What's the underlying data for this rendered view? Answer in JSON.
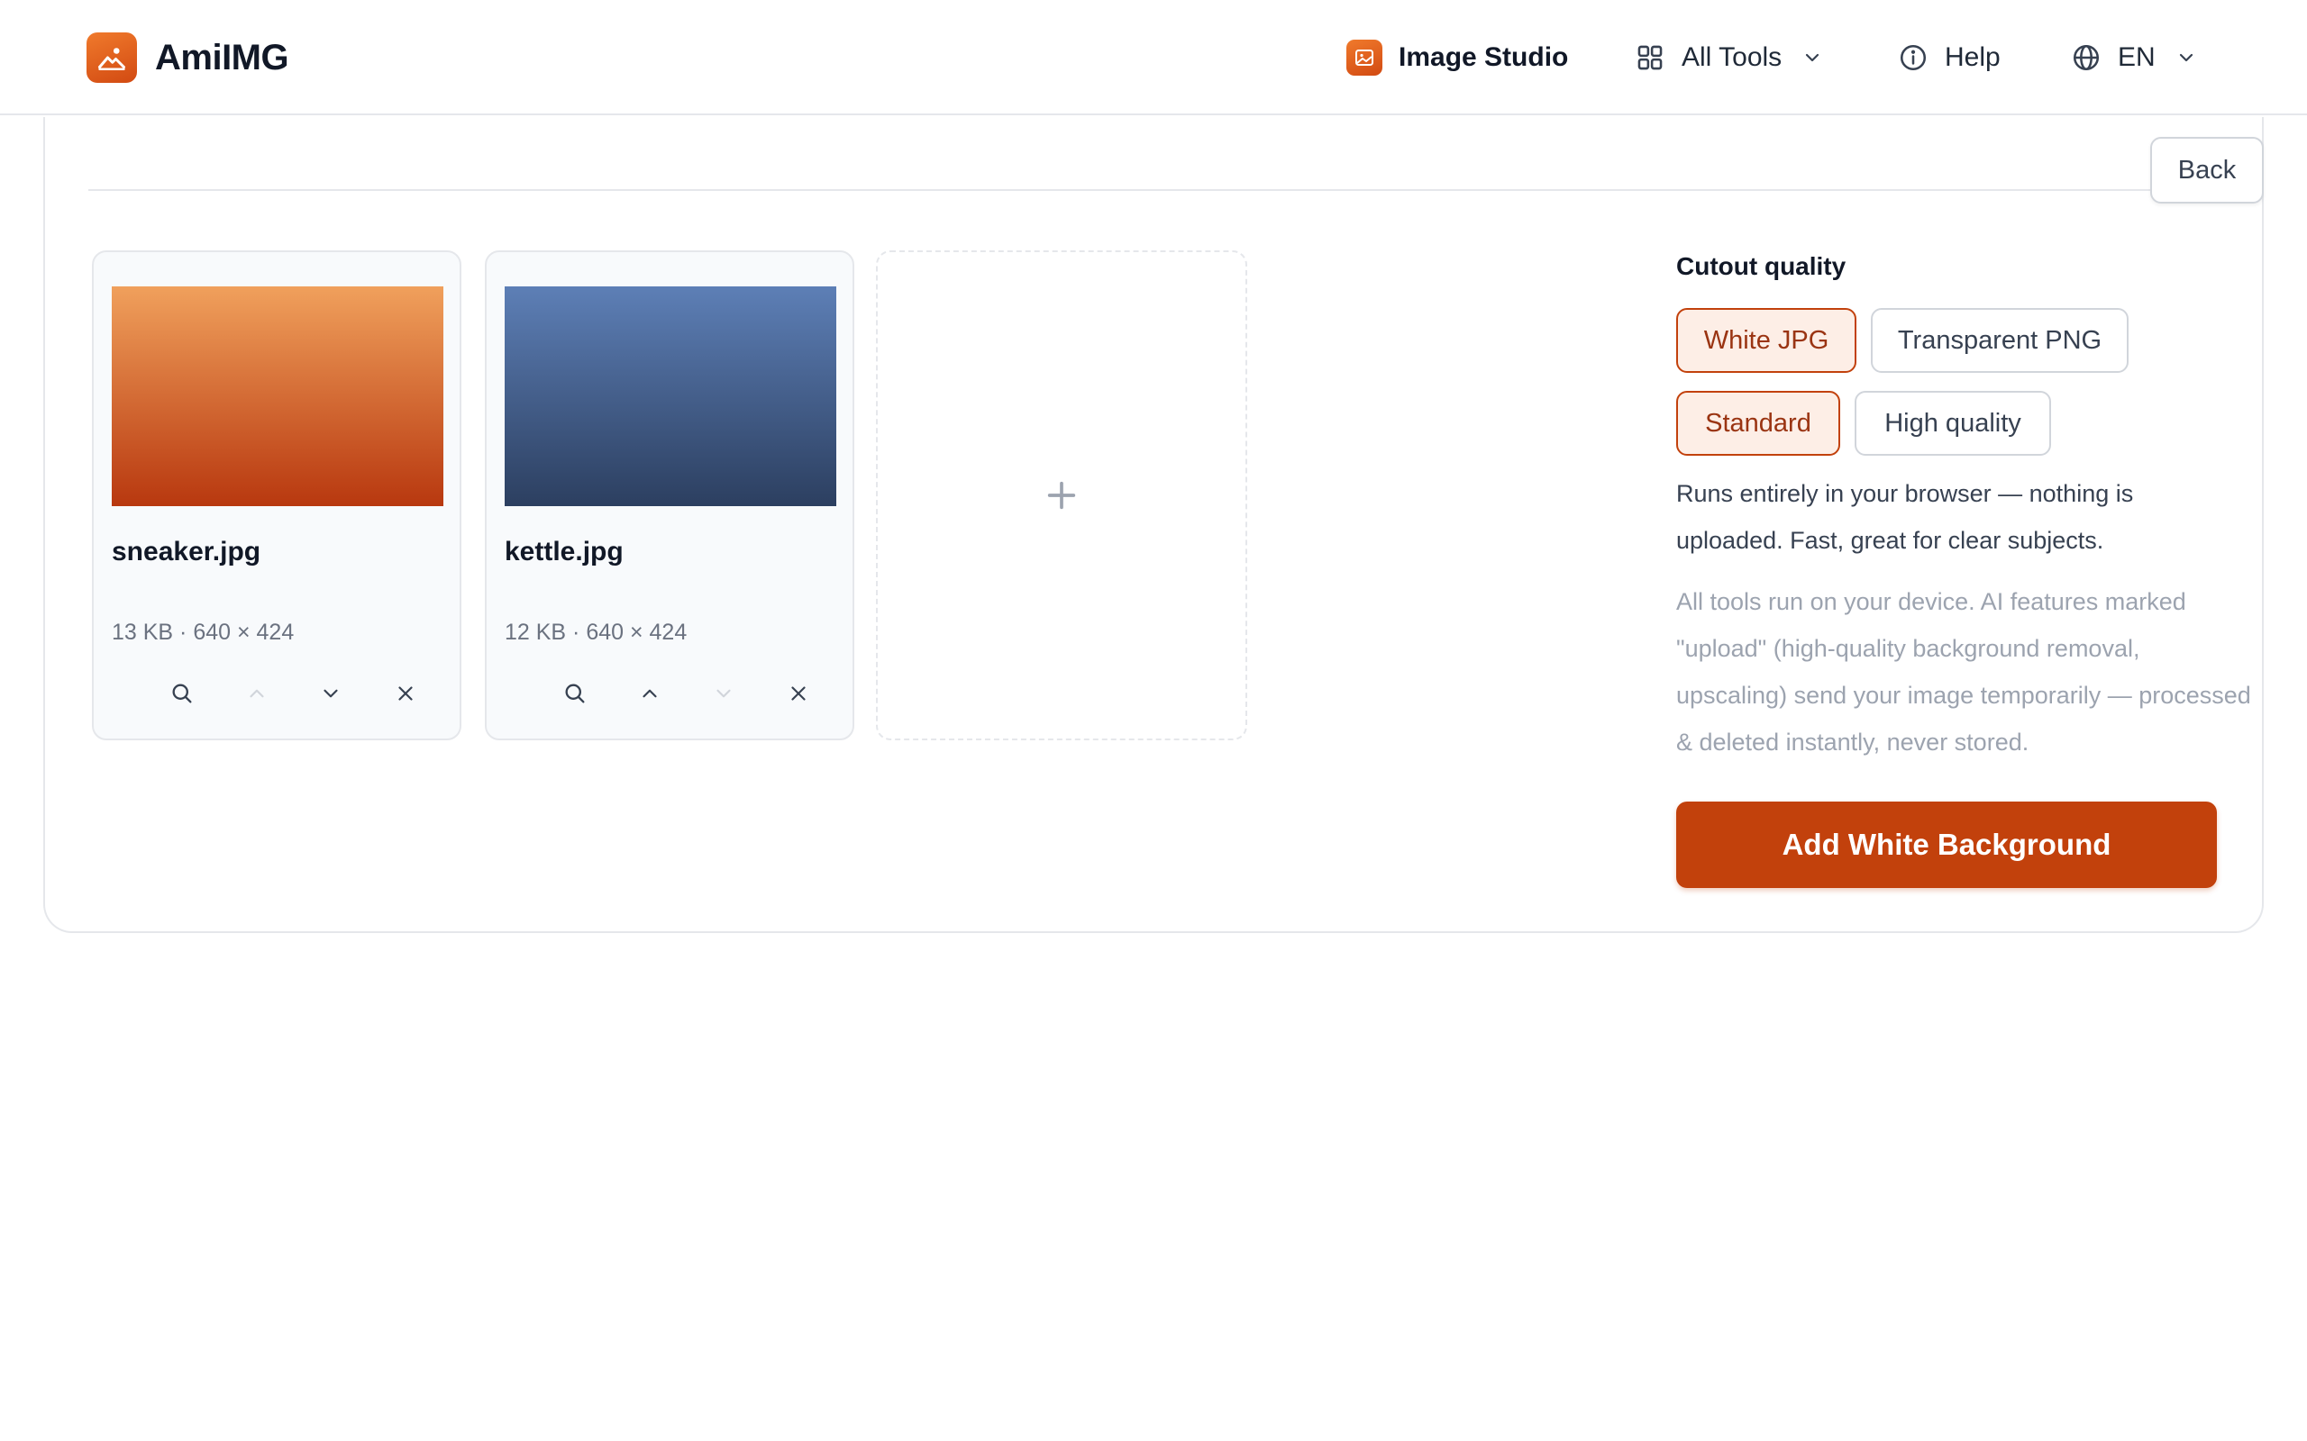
{
  "brand": {
    "name": "AmiIMG",
    "logo_icon": "mountain-sun-icon"
  },
  "nav": {
    "studio_label": "Image Studio",
    "tools_label": "All Tools",
    "help_label": "Help",
    "lang_label": "EN"
  },
  "workspace": {
    "back_label": "Back",
    "files": [
      {
        "name": "sneaker.jpg",
        "meta": "13 KB · 640 × 424"
      },
      {
        "name": "kettle.jpg",
        "meta": "12 KB · 640 × 424"
      }
    ],
    "add_tile_symbol": "+"
  },
  "panel": {
    "title": "Cutout quality",
    "format_options": [
      {
        "label": "White JPG",
        "selected": true
      },
      {
        "label": "Transparent PNG",
        "selected": false
      }
    ],
    "quality_options": [
      {
        "label": "Standard",
        "selected": true
      },
      {
        "label": "High quality",
        "selected": false
      }
    ],
    "description": "Runs entirely in your browser — nothing is uploaded. Fast, great for clear subjects.",
    "note": "All tools run on your device. AI features marked \"upload\" (high-quality background removal, upscaling) send your image temporarily — processed & deleted instantly, never stored.",
    "cta_label": "Add White Background"
  },
  "colors": {
    "accent": "#c2410c",
    "accent_light": "#fdeee6",
    "border": "#e5e7eb",
    "muted_text": "#9ca3af"
  }
}
